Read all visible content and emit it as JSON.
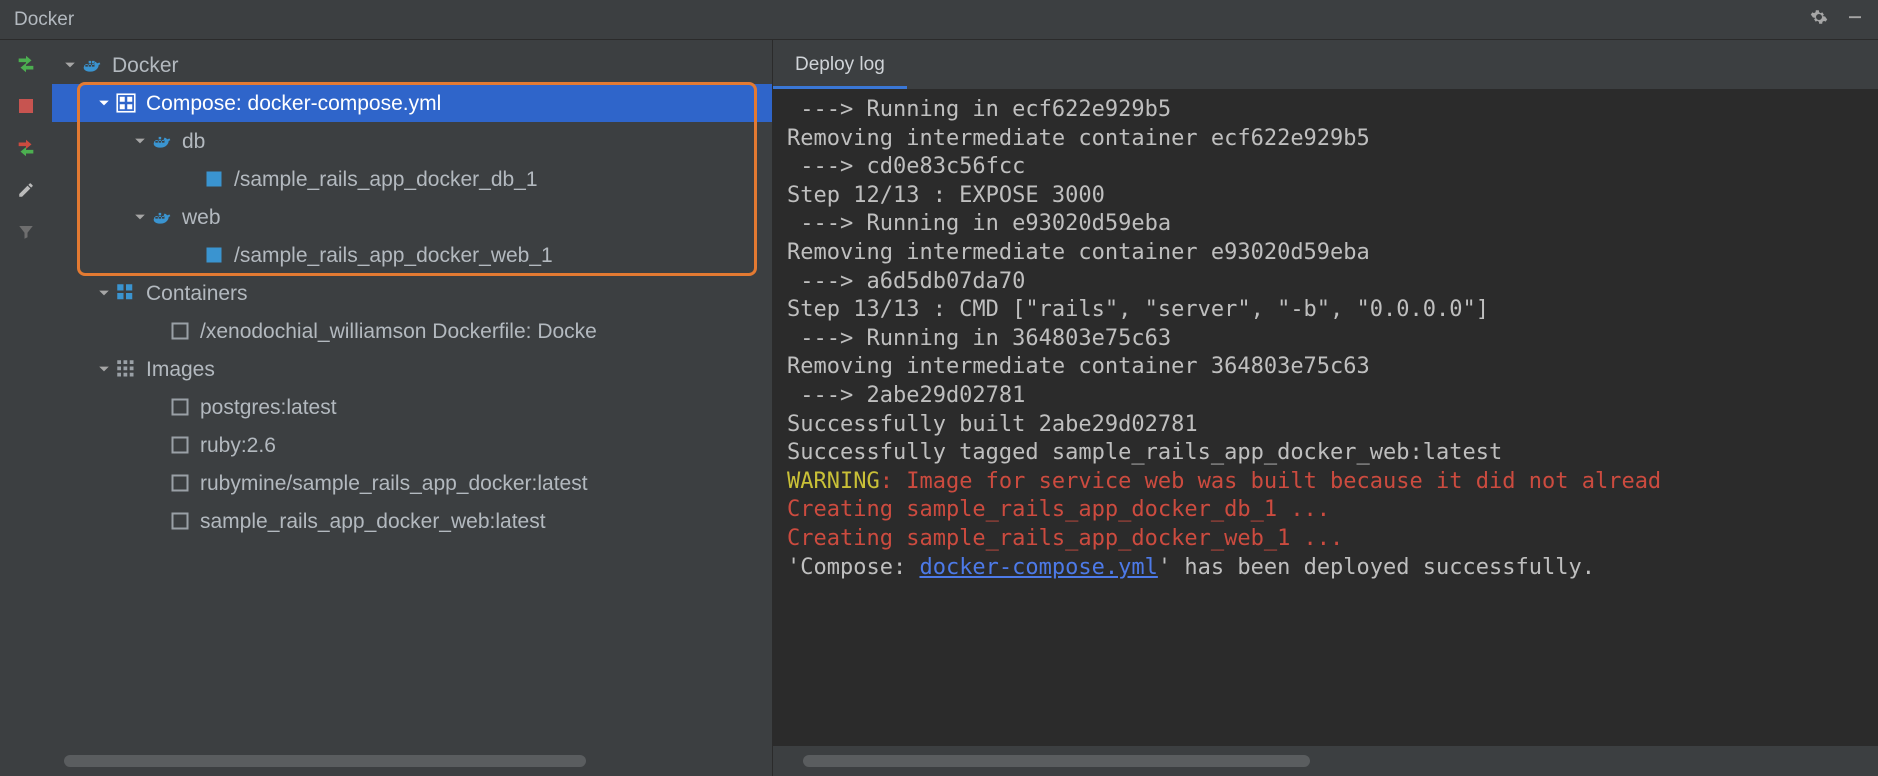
{
  "title": "Docker",
  "tree": {
    "root": "Docker",
    "compose": "Compose: docker-compose.yml",
    "db": "db",
    "db_container": "/sample_rails_app_docker_db_1",
    "web": "web",
    "web_container": "/sample_rails_app_docker_web_1",
    "containers": "Containers",
    "container1": "/xenodochial_williamson Dockerfile: Docke",
    "images": "Images",
    "img1": "postgres:latest",
    "img2": "ruby:2.6",
    "img3": "rubymine/sample_rails_app_docker:latest",
    "img4": "sample_rails_app_docker_web:latest"
  },
  "tabs": {
    "deploy_log": "Deploy log"
  },
  "log": [
    {
      "cls": "",
      "text": " ---> Running in ecf622e929b5"
    },
    {
      "cls": "",
      "text": "Removing intermediate container ecf622e929b5"
    },
    {
      "cls": "",
      "text": " ---> cd0e83c56fcc"
    },
    {
      "cls": "",
      "text": "Step 12/13 : EXPOSE 3000"
    },
    {
      "cls": "",
      "text": " ---> Running in e93020d59eba"
    },
    {
      "cls": "",
      "text": "Removing intermediate container e93020d59eba"
    },
    {
      "cls": "",
      "text": " ---> a6d5db07da70"
    },
    {
      "cls": "",
      "text": "Step 13/13 : CMD [\"rails\", \"server\", \"-b\", \"0.0.0.0\"]"
    },
    {
      "cls": "",
      "text": " ---> Running in 364803e75c63"
    },
    {
      "cls": "",
      "text": "Removing intermediate container 364803e75c63"
    },
    {
      "cls": "",
      "text": " ---> 2abe29d02781"
    },
    {
      "cls": "",
      "text": "Successfully built 2abe29d02781"
    },
    {
      "cls": "",
      "text": "Successfully tagged sample_rails_app_docker_web:latest"
    },
    {
      "cls": "warn",
      "segments": [
        {
          "cls": "c-warn",
          "text": "WARNING"
        },
        {
          "cls": "c-err",
          "text": ": Image for service web was built because it did not alread"
        }
      ]
    },
    {
      "cls": "c-err",
      "text": "Creating sample_rails_app_docker_db_1 ..."
    },
    {
      "cls": "c-err",
      "text": "Creating sample_rails_app_docker_web_1 ..."
    },
    {
      "cls": "final",
      "segments": [
        {
          "cls": "",
          "text": "'Compose: "
        },
        {
          "cls": "c-link",
          "text": "docker-compose.yml"
        },
        {
          "cls": "",
          "text": "' has been deployed successfully."
        }
      ]
    }
  ]
}
